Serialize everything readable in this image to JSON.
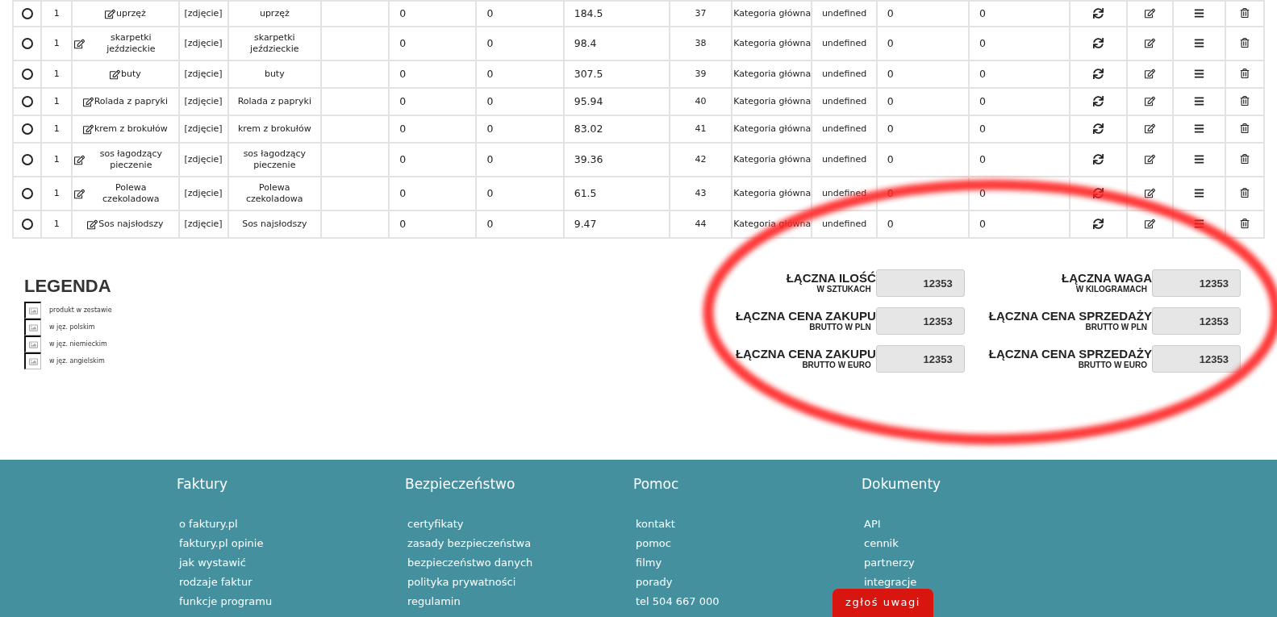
{
  "products": [
    {
      "selected": false,
      "quantity": "1",
      "name": "uprzęż",
      "photo": "[zdjęcie]",
      "name_2": "uprzęż",
      "column_6": "0",
      "column_7": "0",
      "price": "184.5",
      "id": "37",
      "category": "Kategoria główna",
      "column_11": "undefined",
      "column_12": "0",
      "column_13": "0"
    },
    {
      "selected": false,
      "quantity": "1",
      "name": "skarpetki jeździeckie",
      "photo": "[zdjęcie]",
      "name_2": "skarpetki jeździeckie",
      "column_6": "0",
      "column_7": "0",
      "price": "98.4",
      "id": "38",
      "category": "Kategoria główna",
      "column_11": "undefined",
      "column_12": "0",
      "column_13": "0"
    },
    {
      "selected": false,
      "quantity": "1",
      "name": "buty",
      "photo": "[zdjęcie]",
      "name_2": "buty",
      "column_6": "0",
      "column_7": "0",
      "price": "307.5",
      "id": "39",
      "category": "Kategoria główna",
      "column_11": "undefined",
      "column_12": "0",
      "column_13": "0"
    },
    {
      "selected": false,
      "quantity": "1",
      "name": "Rolada z papryki",
      "photo": "[zdjęcie]",
      "name_2": "Rolada z papryki",
      "column_6": "0",
      "column_7": "0",
      "price": "95.94",
      "id": "40",
      "category": "Kategoria główna",
      "column_11": "undefined",
      "column_12": "0",
      "column_13": "0"
    },
    {
      "selected": false,
      "quantity": "1",
      "name": "krem z brokułów",
      "photo": "[zdjęcie]",
      "name_2": "krem z brokułów",
      "column_6": "0",
      "column_7": "0",
      "price": "83.02",
      "id": "41",
      "category": "Kategoria główna",
      "column_11": "undefined",
      "column_12": "0",
      "column_13": "0"
    },
    {
      "selected": false,
      "quantity": "1",
      "name": "sos łagodzący pieczenie",
      "photo": "[zdjęcie]",
      "name_2": "sos łagodzący pieczenie",
      "column_6": "0",
      "column_7": "0",
      "price": "39.36",
      "id": "42",
      "category": "Kategoria główna",
      "column_11": "undefined",
      "column_12": "0",
      "column_13": "0"
    },
    {
      "selected": false,
      "quantity": "1",
      "name": "Polewa czekoladowa",
      "photo": "[zdjęcie]",
      "name_2": "Polewa czekoladowa",
      "column_6": "0",
      "column_7": "0",
      "price": "61.5",
      "id": "43",
      "category": "Kategoria główna",
      "column_11": "undefined",
      "column_12": "0",
      "column_13": "0"
    },
    {
      "selected": false,
      "quantity": "1",
      "name": "Sos najsłodszy",
      "photo": "[zdjęcie]",
      "name_2": "Sos najsłodszy",
      "column_6": "0",
      "column_7": "0",
      "price": "9.47",
      "id": "44",
      "category": "Kategoria główna",
      "column_11": "undefined",
      "column_12": "0",
      "column_13": "0"
    }
  ],
  "legend": {
    "title": "LEGENDA",
    "items": [
      "produkt w zestawie",
      "w jęz. polskim",
      "w jęz. niemieckim",
      "w jęz. angielskim"
    ]
  },
  "totals": [
    {
      "label": "ŁĄCZNA ILOŚĆ",
      "sublabel": "W SZTUKACH",
      "value": "12353"
    },
    {
      "label": "ŁĄCZNA WAGA",
      "sublabel": "W KILOGRAMACH",
      "value": "12353"
    },
    {
      "label": "ŁĄCZNA CENA ZAKUPU",
      "sublabel": "BRUTTO W PLN",
      "value": "12353"
    },
    {
      "label": "ŁĄCZNA CENA SPRZEDAŻY",
      "sublabel": "BRUTTO W PLN",
      "value": "12353"
    },
    {
      "label": "ŁĄCZNA CENA ZAKUPU",
      "sublabel": "BRUTTO W EURO",
      "value": "12353"
    },
    {
      "label": "ŁĄCZNA CENA SPRZEDAŻY",
      "sublabel": "BRUTTO W EURO",
      "value": "12353"
    }
  ],
  "footer": [
    {
      "heading": "Faktury",
      "links": [
        "o faktury.pl",
        "faktury.pl opinie",
        "jak wystawić",
        "rodzaje faktur",
        "funkcje programu"
      ]
    },
    {
      "heading": "Bezpieczeństwo",
      "links": [
        "certyfikaty",
        "zasady bezpieczeństwa",
        "bezpieczeństwo danych",
        "polityka prywatności",
        "regulamin"
      ]
    },
    {
      "heading": "Pomoc",
      "links": [
        "kontakt",
        "pomoc",
        "filmy",
        "porady",
        "tel 504 667 000"
      ]
    },
    {
      "heading": "Dokumenty",
      "links": [
        "API",
        "cennik",
        "partnerzy",
        "integracje"
      ]
    }
  ],
  "feedback_button": "zgłoś uwagi"
}
